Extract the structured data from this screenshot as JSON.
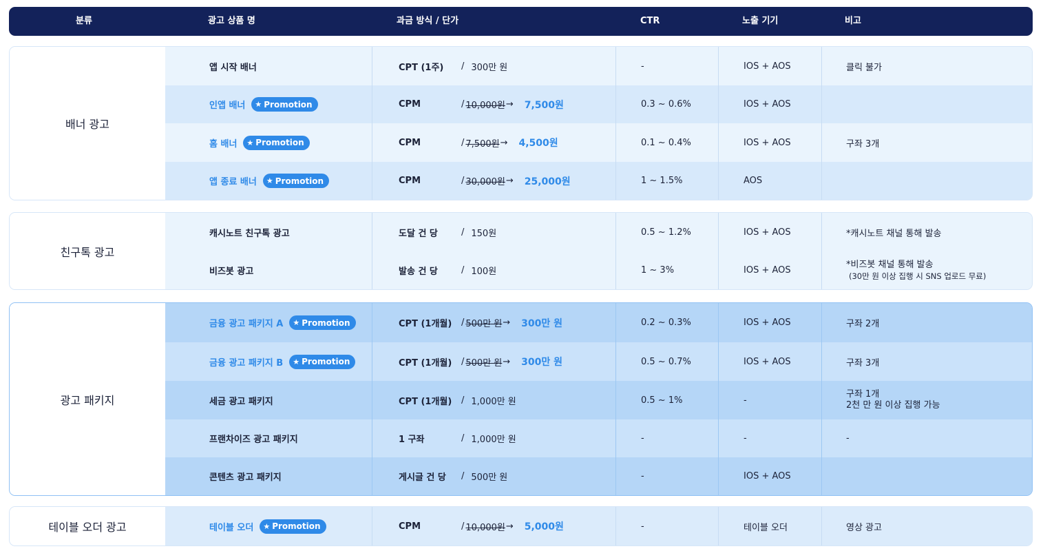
{
  "header": {
    "category": "분류",
    "product": "광고 상품 명",
    "billing": "과금 방식 / 단가",
    "ctr": "CTR",
    "device": "노출 기기",
    "note": "비고"
  },
  "promotion_label": "Promotion",
  "groups": [
    {
      "label": "배너 광고",
      "rows": [
        {
          "name": "앱 시작 배너",
          "promo": false,
          "billing": "CPT (1주)",
          "price": "300만 원",
          "ctr": "-",
          "device": "IOS + AOS",
          "note": "클릭 불가"
        },
        {
          "name": "인앱 배너",
          "promo": true,
          "billing": "CPM",
          "old_price": "10,000원",
          "arrow": "→",
          "new_price": "7,500원",
          "ctr": "0.3 ~ 0.6%",
          "device": "IOS + AOS",
          "note": ""
        },
        {
          "name": "홈 배너",
          "promo": true,
          "billing": "CPM",
          "old_price": "7,500원",
          "arrow": "→",
          "new_price": "4,500원",
          "ctr": "0.1 ~ 0.4%",
          "device": "IOS + AOS",
          "note": "구좌 3개"
        },
        {
          "name": "앱 종료 배너",
          "promo": true,
          "billing": "CPM",
          "old_price": "30,000원",
          "arrow": "→",
          "new_price": "25,000원",
          "ctr": "1 ~ 1.5%",
          "device": "AOS",
          "note": ""
        }
      ]
    },
    {
      "label": "친구톡 광고",
      "rows": [
        {
          "name": "캐시노트 친구톡 광고",
          "promo": false,
          "billing": "도달 건 당",
          "price": "150원",
          "ctr": "0.5 ~ 1.2%",
          "device": "IOS + AOS",
          "note": "*캐시노트 채널 통해 발송"
        },
        {
          "name": "비즈봇 광고",
          "promo": false,
          "billing": "발송 건 당",
          "price": "100원",
          "ctr": "1 ~ 3%",
          "device": "IOS + AOS",
          "note": "*비즈봇 채널 통해 발송",
          "note2": "(30만 원 이상 집행 시 SNS 업로드 무료)"
        }
      ]
    },
    {
      "label": "광고 패키지",
      "rows": [
        {
          "name": "금융 광고 패키지 A",
          "promo": true,
          "billing": "CPT (1개월)",
          "old_price": "500만 원",
          "arrow": "→",
          "new_price": "300만 원",
          "ctr": "0.2 ~ 0.3%",
          "device": "IOS + AOS",
          "note": "구좌 2개"
        },
        {
          "name": "금융 광고 패키지 B",
          "promo": true,
          "billing": "CPT (1개월)",
          "old_price": "500만 원",
          "arrow": "→",
          "new_price": "300만 원",
          "ctr": "0.5 ~ 0.7%",
          "device": "IOS + AOS",
          "note": "구좌 3개"
        },
        {
          "name": "세금 광고 패키지",
          "promo": false,
          "billing": "CPT (1개월)",
          "price": "1,000만 원",
          "ctr": "0.5 ~ 1%",
          "device": "-",
          "note": "구좌 1개",
          "note2": "2천 만 원 이상 집행 가능"
        },
        {
          "name": "프랜차이즈 광고 패키지",
          "promo": false,
          "billing": "1 구좌",
          "price": "1,000만 원",
          "ctr": "-",
          "device": "-",
          "note": "-"
        },
        {
          "name": "콘텐츠 광고 패키지",
          "promo": false,
          "billing": "게시글 건 당",
          "price": "500만 원",
          "ctr": "-",
          "device": "IOS + AOS",
          "note": ""
        }
      ]
    },
    {
      "label": "테이블 오더 광고",
      "rows": [
        {
          "name": "테이블 오더",
          "promo": true,
          "billing": "CPM",
          "old_price": "10,000원",
          "arrow": "→",
          "new_price": "5,000원",
          "ctr": "-",
          "device": "테이블 오더",
          "note": "영상 광고"
        }
      ]
    }
  ],
  "colors": {
    "header_bg": "#13225a",
    "accent": "#2f8ae8",
    "banner_row_a": "#eaf4fd",
    "banner_row_b": "#d7e9fb",
    "pkg_row_a": "#b5d6f7",
    "pkg_row_b": "#cae2fa",
    "table_order_row": "#dbebfb"
  }
}
